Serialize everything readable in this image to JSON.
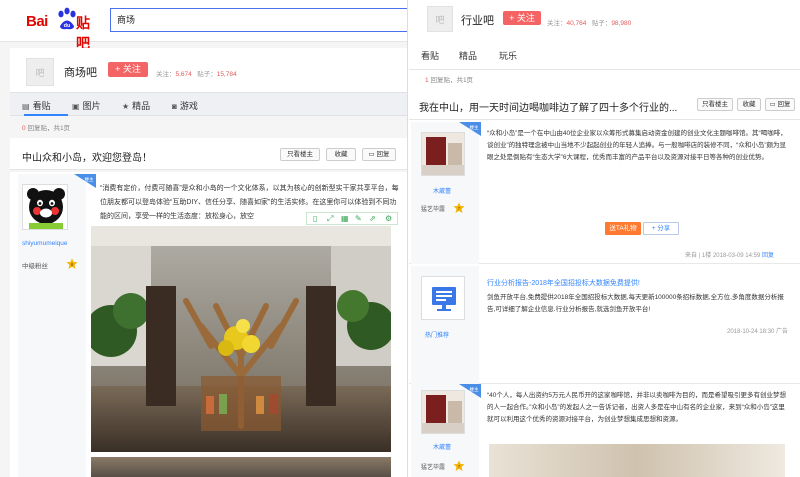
{
  "left": {
    "logo": {
      "bai": "Bai",
      "tieba": "贴吧"
    },
    "search": {
      "value": "商场"
    },
    "forum": {
      "avatar_text": "吧",
      "name": "商场吧",
      "follow_label": "+ 关注",
      "follow_count_label": "关注：",
      "follow_count": "5,674",
      "posts_count_label": "贴子：",
      "posts_count": "15,784"
    },
    "tabs": [
      {
        "icon": "home",
        "label": "看贴"
      },
      {
        "icon": "image",
        "label": "图片"
      },
      {
        "icon": "star",
        "label": "精品"
      },
      {
        "icon": "gamepad",
        "label": "游戏"
      }
    ],
    "reply_count": {
      "num": "0",
      "rest": "回复贴，共1页"
    },
    "thread": {
      "title": "中山众和小岛，欢迎您登岛！",
      "btn_only_op": "只看楼主",
      "btn_collect": "收藏",
      "btn_reply": "回复"
    },
    "post": {
      "username": "shiyumumeique",
      "level_title": "中级粉丝",
      "level_num": "8",
      "op_tag": "楼主",
      "text": "“消费有定价，付费可随喜”是众和小岛的一个文化体系，以其为核心的创新型实干家共享平台，每位朋友都可以登岛体验“互助DIY、信任分享、随喜如家”的生活实修。在这里你可以体验到不同功能的区间，享受一样的生活态度：放松身心，放空"
    }
  },
  "right": {
    "forum": {
      "avatar_text": "吧",
      "name": "行业吧",
      "follow_label": "+ 关注",
      "follow_count_label": "关注：",
      "follow_count": "40,764",
      "posts_count_label": "贴子：",
      "posts_count": "98,980"
    },
    "tabs": [
      "看贴",
      "精品",
      "玩乐"
    ],
    "reply_count": {
      "num": "1",
      "rest": "回复贴，共1页"
    },
    "thread": {
      "title": "我在中山，用一天时间边喝咖啡边了解了四十多个行业的...",
      "btn_only_op": "只看楼主",
      "btn_collect": "收藏",
      "btn_reply": "回复"
    },
    "post1": {
      "username": "木葳蕾",
      "level_title": "猛艺毕露",
      "level_num": "7",
      "op_tag": "楼主",
      "text": "“众和小岛”是一个在中山由40位企业家以众筹形式募集启动资金创建的创业文化主题咖啡馆。其“喝咖啡，谈创业”的独特理念被中山当地不少起起创业的年轻人追捧。与一般咖啡店的装修不同，“众和小岛”颇为显眼之处是倒贴有“生态大学”6大课程，优秀而丰富的产品平台以及资源对接平日等各种的创业优势。",
      "gift_label": "送TA礼物",
      "share_label": "分享",
      "meta_client": "来自",
      "meta_floor": "1楼",
      "meta_time": "2018-03-09 14:59",
      "meta_reply": "回复"
    },
    "ad": {
      "username": "热门推荐",
      "title": "行业分析报告-2018年全国招投标大数据免费提供!",
      "text": "剑鱼开放平台,免费提供2018年全国招投标大数据,每天更新100000条招标数据,全方位,多角度数据分析报告,可详细了解企业信息.行业分析报告,就选剑鱼开放平台!",
      "meta_time": "2018-10-24 18:30",
      "meta_ad": "广告"
    },
    "post2": {
      "username": "木葳蕾",
      "level_title": "猛艺毕露",
      "level_num": "7",
      "op_tag": "楼主",
      "text": "“40个人，每人出资约5万元人民币开的这家咖啡馆，并非以卖咖啡为目的，而是希望吸引更多有创业梦想的人一起合作。”众和小岛”的发起人之一告诉记者，出资人多是在中山有名的企业家，来到“众和小岛”这里就可以利用这个优秀的资源对接平台，为创业梦想集成思想和资源。"
    }
  }
}
